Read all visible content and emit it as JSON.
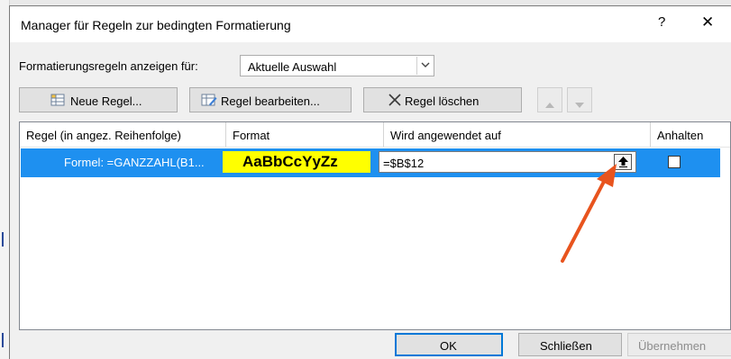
{
  "dialog": {
    "title": "Manager für Regeln zur bedingten Formatierung",
    "help_glyph": "?",
    "close_glyph": "✕"
  },
  "show_rules": {
    "label": "Formatierungsregeln anzeigen für:",
    "selected_value": "Aktuelle Auswahl"
  },
  "toolbar": {
    "new_rule": "Neue Regel...",
    "edit_rule": "Regel bearbeiten...",
    "delete_rule": "Regel löschen",
    "move_up_icon": "triangle-up-icon",
    "move_down_icon": "triangle-down-icon"
  },
  "grid": {
    "columns": [
      "Regel (in angez. Reihenfolge)",
      "Format",
      "Wird angewendet auf",
      "Anhalten"
    ],
    "rows": [
      {
        "rule": "Formel: =GANZZAHL(B1...",
        "format_preview": "AaBbCcYyZz",
        "applies_to": "=$B$12",
        "stop_if_true": false,
        "selected": true
      }
    ]
  },
  "footer": {
    "ok": "OK",
    "close": "Schließen",
    "apply": "Übernehmen"
  },
  "colors": {
    "selection": "#1e90f0",
    "preview_fill": "#ffff00",
    "annotation_arrow": "#e8541e"
  }
}
